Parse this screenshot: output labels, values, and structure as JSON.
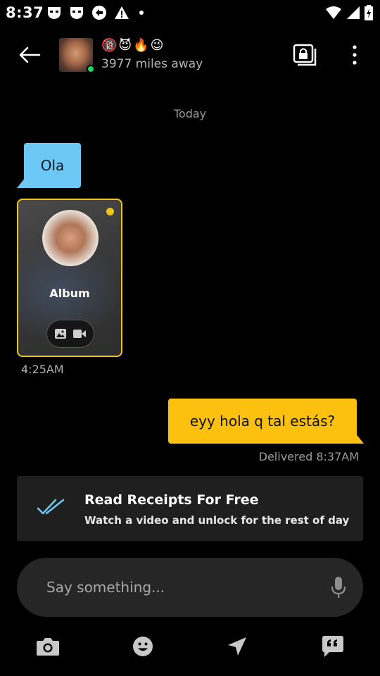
{
  "status_bar": {
    "time": "8:37"
  },
  "header": {
    "display_name": [
      "🔞",
      "😈",
      "🔥",
      "😉"
    ],
    "distance": "3977 miles away"
  },
  "chat": {
    "day_label": "Today",
    "incoming_message": "Ola",
    "album": {
      "title": "Album"
    },
    "incoming_time": "4:25AM",
    "outgoing_message": "eyy hola q tal estás?",
    "delivered_status": "Delivered 8:37AM"
  },
  "promo": {
    "title": "Read Receipts For Free",
    "subtitle": "Watch a video and unlock for the rest of day"
  },
  "composer": {
    "placeholder": "Say something..."
  },
  "colors": {
    "incoming_bubble": "#6ec8f5",
    "outgoing_bubble": "#fcc00e",
    "album_border": "#f0c518",
    "online": "#1ed760",
    "receipt_check": "#6ec8f5"
  },
  "icons": {
    "back": "arrow-left-icon",
    "album": "locked-album-icon",
    "menu": "more-vertical-icon",
    "mic": "microphone-icon",
    "camera": "camera-icon",
    "emoji": "emoji-icon",
    "location": "location-arrow-icon",
    "phrases": "quote-bubble-icon"
  }
}
